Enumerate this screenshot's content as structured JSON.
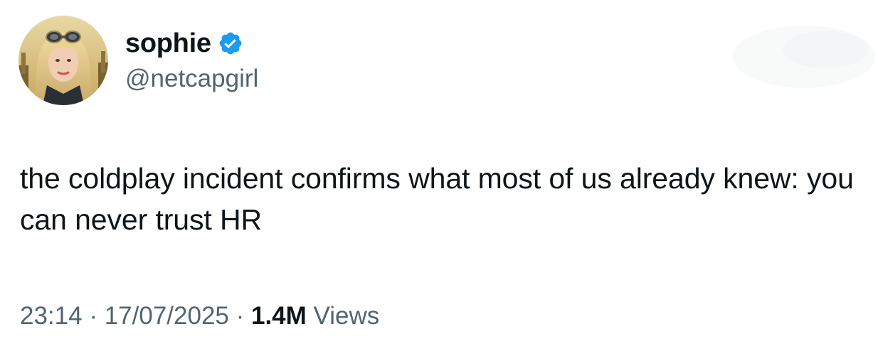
{
  "author": {
    "display_name": "sophie",
    "handle": "@netcapgirl",
    "verified_icon": "verified-badge-icon",
    "verified_color": "#1d9bf0"
  },
  "tweet": {
    "text": "the coldplay incident confirms what most of us already knew: you can never trust HR"
  },
  "meta": {
    "time": "23:14",
    "separator": " · ",
    "date": "17/07/2025",
    "views_count": "1.4M",
    "views_label": " Views"
  },
  "colors": {
    "text_primary": "#0f1419",
    "text_secondary": "#536471",
    "accent": "#1d9bf0"
  }
}
